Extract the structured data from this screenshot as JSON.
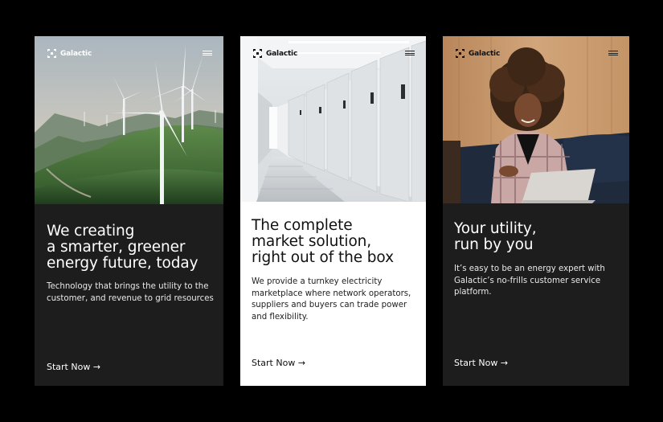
{
  "brand": {
    "name": "Galactic",
    "icon": "galactic-logo-icon",
    "menu_icon": "hamburger-menu-icon"
  },
  "colors": {
    "page_background": "#000000",
    "dark_card": "#1d1d1d",
    "light_card": "#ffffff"
  },
  "cards": [
    {
      "image": "wind-turbines-on-green-hills",
      "headline": [
        "We creating",
        "a smarter, greener",
        "energy future, today"
      ],
      "body": [
        "Technology that brings the utility to the",
        "customer, and revenue to grid resources"
      ],
      "cta": "Start Now →"
    },
    {
      "image": "data-center-server-aisle",
      "headline": [
        "The complete",
        "market solution,",
        "right out of the box"
      ],
      "body": [
        "We provide a turnkey electricity",
        "marketplace where network operators,",
        "suppliers and buyers can trade power",
        "and flexibility."
      ],
      "cta": "Start Now →"
    },
    {
      "image": "woman-smiling-at-laptop",
      "headline": [
        "Your utility,",
        "run by you"
      ],
      "body": [
        "It’s easy to be an energy expert with",
        "Galactic’s no-frills customer service",
        "platform."
      ],
      "cta": "Start Now →"
    }
  ]
}
